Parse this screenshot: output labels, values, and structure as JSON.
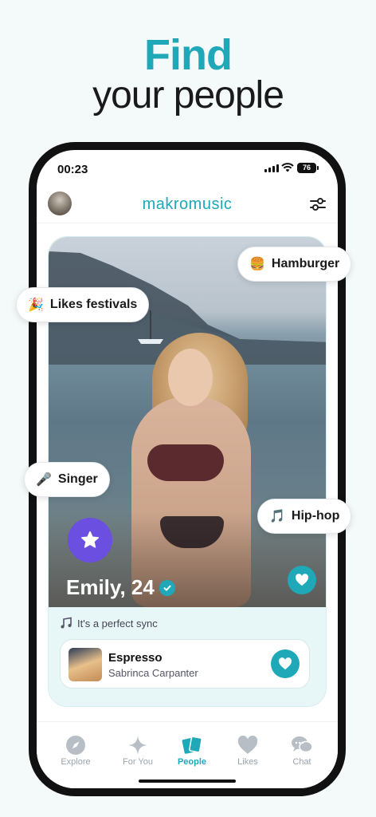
{
  "headline": {
    "line1": "Find",
    "line2": "your people",
    "accent_color": "#1ea8b8"
  },
  "status_bar": {
    "time": "00:23",
    "battery": "76"
  },
  "app": {
    "logo": "makromusic"
  },
  "profile": {
    "name_age": "Emily, 24"
  },
  "tags": [
    {
      "emoji": "🍔",
      "label": "Hamburger",
      "icon": "hamburger-icon"
    },
    {
      "emoji": "🎉",
      "label": "Likes festivals",
      "icon": "party-popper-icon"
    },
    {
      "emoji": "🎤",
      "label": "Singer",
      "icon": "microphone-icon"
    },
    {
      "emoji": "🎵",
      "label": "Hip-hop",
      "icon": "music-note-icon"
    }
  ],
  "sync": {
    "text": "It's a perfect sync",
    "icon": "music-note-icon"
  },
  "song": {
    "title": "Espresso",
    "artist": "Sabrinca Carpanter"
  },
  "tabs": [
    {
      "label": "Explore",
      "icon": "compass-icon",
      "active": false
    },
    {
      "label": "For You",
      "icon": "sparkle-icon",
      "active": false
    },
    {
      "label": "People",
      "icon": "cards-icon",
      "active": true
    },
    {
      "label": "Likes",
      "icon": "heart-icon",
      "active": false
    },
    {
      "label": "Chat",
      "icon": "chat-bubbles-icon",
      "active": false
    }
  ]
}
